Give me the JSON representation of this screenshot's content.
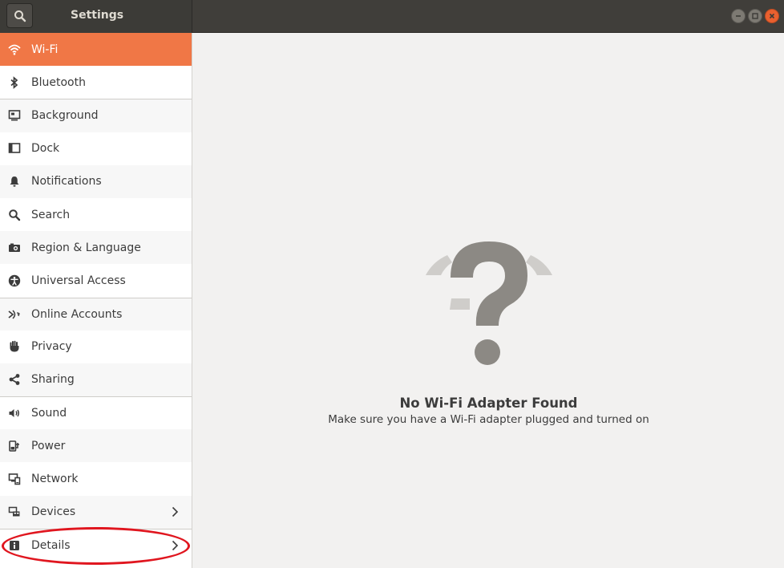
{
  "window": {
    "title": "Settings"
  },
  "colors": {
    "accent": "#f07746",
    "header": "#403e3a",
    "close": "#e9602f",
    "annotation": "#e0161f"
  },
  "sidebar": {
    "items": [
      {
        "label": "Wi-Fi",
        "icon": "wifi-icon",
        "active": true
      },
      {
        "label": "Bluetooth",
        "icon": "bluetooth-icon"
      },
      {
        "label": "Background",
        "icon": "background-icon"
      },
      {
        "label": "Dock",
        "icon": "dock-icon"
      },
      {
        "label": "Notifications",
        "icon": "bell-icon"
      },
      {
        "label": "Search",
        "icon": "search-icon"
      },
      {
        "label": "Region & Language",
        "icon": "camera-icon"
      },
      {
        "label": "Universal Access",
        "icon": "accessibility-icon"
      },
      {
        "label": "Online Accounts",
        "icon": "online-accounts-icon"
      },
      {
        "label": "Privacy",
        "icon": "hand-icon"
      },
      {
        "label": "Sharing",
        "icon": "share-icon"
      },
      {
        "label": "Sound",
        "icon": "speaker-icon"
      },
      {
        "label": "Power",
        "icon": "power-plug-icon"
      },
      {
        "label": "Network",
        "icon": "network-icon"
      },
      {
        "label": "Devices",
        "icon": "devices-icon",
        "chevron": true
      },
      {
        "label": "Details",
        "icon": "info-icon",
        "chevron": true
      }
    ]
  },
  "main": {
    "title": "No Wi-Fi Adapter Found",
    "subtitle": "Make sure you have a Wi-Fi adapter plugged and turned on",
    "icon": "question-mark-wifi-icon"
  }
}
